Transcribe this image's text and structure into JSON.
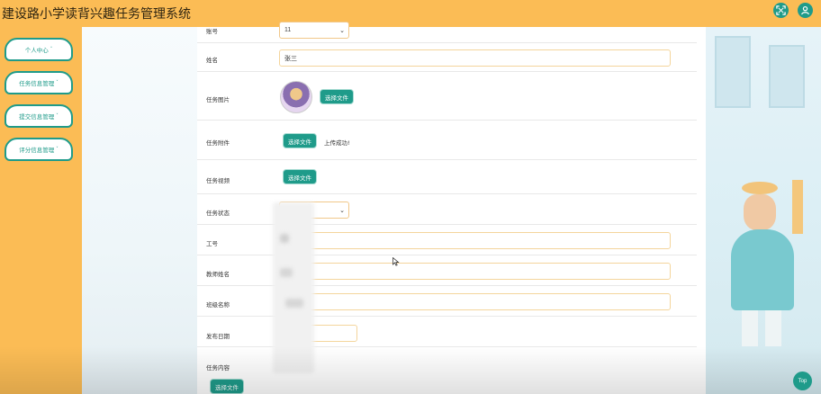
{
  "header": {
    "title": "建设路小学读背兴趣任务管理系统"
  },
  "header_icons": {
    "fullscreen": "fullscreen-icon",
    "user": "user-icon"
  },
  "sidebar": {
    "items": [
      {
        "label": "个人中心"
      },
      {
        "label": "任务信息管理"
      },
      {
        "label": "提交信息管理"
      },
      {
        "label": "评分信息管理"
      }
    ],
    "caret": "˅"
  },
  "form": {
    "account": {
      "label": "账号",
      "value": "11"
    },
    "name": {
      "label": "姓名",
      "value": "张三"
    },
    "task_image": {
      "label": "任务图片",
      "button": "选择文件"
    },
    "task_attachment": {
      "label": "任务附件",
      "button": "选择文件",
      "status": "上传成功!"
    },
    "task_video": {
      "label": "任务视频",
      "button": "选择文件"
    },
    "task_status": {
      "label": "任务状态"
    },
    "employee_id": {
      "label": "工号"
    },
    "teacher_name": {
      "label": "教师姓名"
    },
    "class_name": {
      "label": "班级名称"
    },
    "publish_date": {
      "label": "发布日期"
    },
    "task_content": {
      "label": "任务内容",
      "button": "选择文件"
    }
  },
  "top_button": {
    "label": "Top"
  },
  "colors": {
    "accent": "#1f9b8a",
    "header": "#fbbc55",
    "input_border": "#f4d59c"
  }
}
